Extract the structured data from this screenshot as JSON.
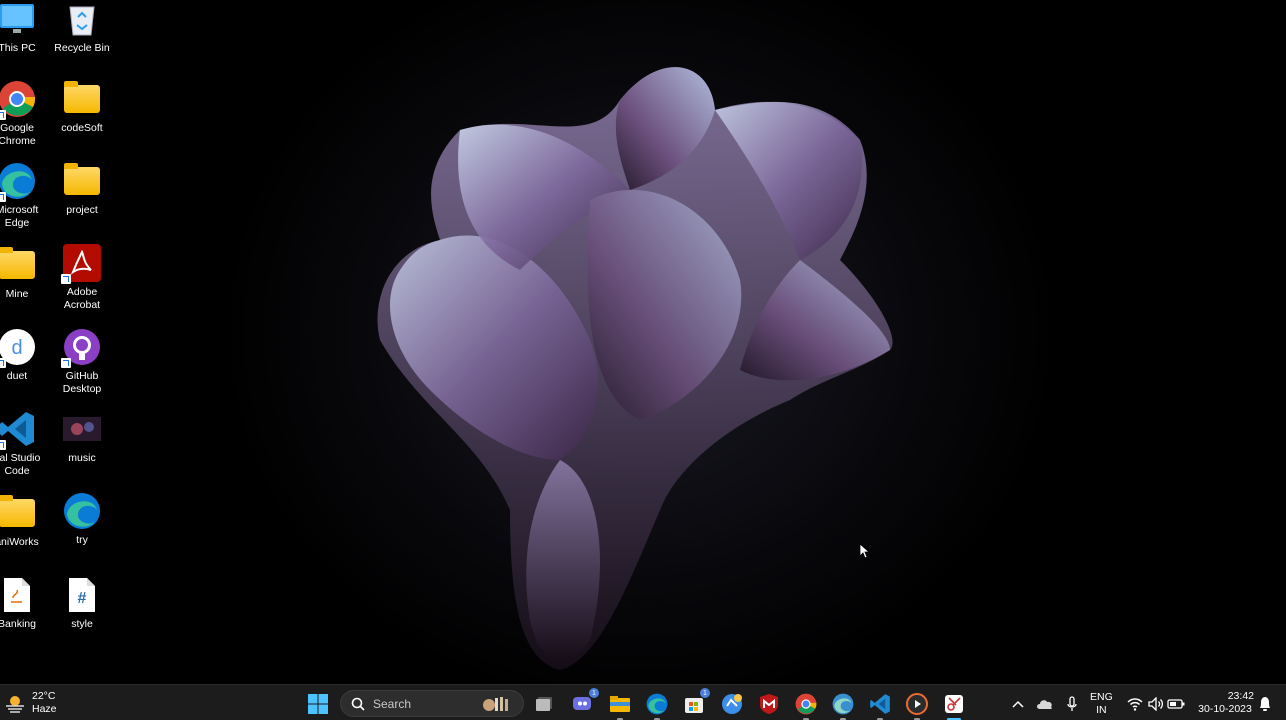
{
  "desktop": {
    "icons": [
      {
        "label": "This PC"
      },
      {
        "label": "Recycle Bin"
      },
      {
        "label": "Google Chrome"
      },
      {
        "label": "codeSoft"
      },
      {
        "label": "Microsoft Edge"
      },
      {
        "label": "project"
      },
      {
        "label": "Mine"
      },
      {
        "label": "Adobe Acrobat"
      },
      {
        "label": "duet"
      },
      {
        "label": "GitHub Desktop"
      },
      {
        "label": "ual Studio Code"
      },
      {
        "label": "music"
      },
      {
        "label": "aniWorks"
      },
      {
        "label": "try"
      },
      {
        "label": "Banking"
      },
      {
        "label": "style"
      }
    ]
  },
  "taskbar": {
    "weather": {
      "temp": "22°C",
      "condition": "Haze"
    },
    "search": {
      "placeholder": "Search"
    },
    "tray": {
      "lang_line1": "ENG",
      "lang_line2": "IN",
      "time": "23:42",
      "date": "30-10-2023"
    },
    "badges": {
      "chat": "1",
      "store": "1"
    }
  },
  "colors": {
    "taskbar_bg": "#1c1c1c",
    "accent": "#4cc2ff"
  }
}
